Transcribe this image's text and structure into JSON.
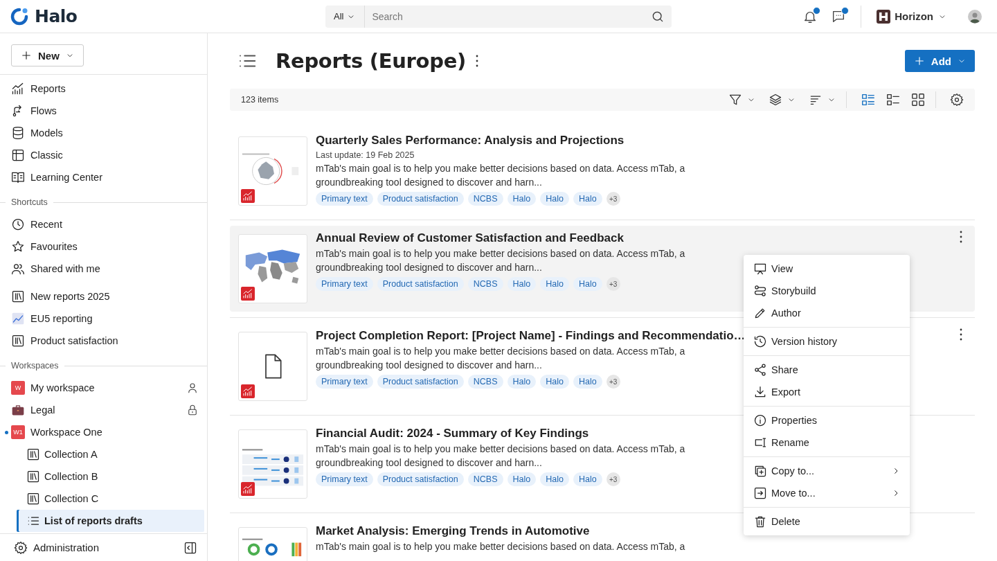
{
  "header": {
    "logo": "Halo",
    "search": {
      "scope": "All",
      "placeholder": "Search"
    },
    "notifications": [
      {
        "kind": "bell",
        "unread": true
      },
      {
        "kind": "chat",
        "unread": true
      }
    ],
    "workspace": "Horizon"
  },
  "sidebar": {
    "new_button": "New",
    "groups": [
      {
        "items": [
          {
            "label": "Reports",
            "selected": false
          },
          {
            "label": "Flows",
            "selected": false
          },
          {
            "label": "Models",
            "selected": false
          },
          {
            "label": "Classic",
            "selected": false
          },
          {
            "label": "Learning Center",
            "selected": false
          }
        ]
      },
      {
        "title": "Shortcuts",
        "items": [
          {
            "label": "Recent",
            "selected": false
          },
          {
            "label": "Favourites",
            "selected": false
          },
          {
            "label": "Shared with me",
            "selected": false
          }
        ]
      },
      {
        "items": [
          {
            "label": "New reports 2025",
            "selected": false
          },
          {
            "label": "EU5 reporting",
            "selected": false
          },
          {
            "label": "Product satisfaction",
            "selected": false
          }
        ]
      },
      {
        "title": "Workspaces",
        "items": [
          {
            "label": "My workspace",
            "badge": "W",
            "selected": false
          },
          {
            "label": "Legal",
            "selected": false
          },
          {
            "label": "Workspace One",
            "badge": "W1",
            "has_updates": true,
            "selected": false,
            "children": [
              {
                "label": "Collection A",
                "selected": false
              },
              {
                "label": "Collection B",
                "selected": false
              },
              {
                "label": "Collection C",
                "selected": false
              },
              {
                "label": "List of reports drafts",
                "selected": true
              }
            ]
          }
        ]
      }
    ],
    "footer": "Administration"
  },
  "main": {
    "title": "Reports (Europe)",
    "add_button": "Add",
    "item_count": "123 items",
    "views": [
      {
        "kind": "details",
        "selected": true
      },
      {
        "kind": "list",
        "selected": false
      },
      {
        "kind": "grid",
        "selected": false
      }
    ],
    "reports": [
      {
        "title": "Quarterly Sales Performance: Analysis and Projections",
        "last_update": "Last update: 19 Feb 2025",
        "description": "mTab's main goal is to help you make better decisions based on data. Access mTab, a groundbreaking tool designed to discover and harn...",
        "tags": [
          "Primary text",
          "Product satisfaction",
          "NCBS",
          "Halo",
          "Halo",
          "Halo"
        ],
        "more_tags": "+3",
        "highlighted": false,
        "actions_visible": false
      },
      {
        "title": "Annual Review of Customer Satisfaction and Feedback",
        "description": "mTab's main goal is to help you make better decisions based on data. Access mTab, a groundbreaking tool designed to discover and harn...",
        "tags": [
          "Primary text",
          "Product satisfaction",
          "NCBS",
          "Halo",
          "Halo",
          "Halo"
        ],
        "more_tags": "+3",
        "highlighted": true,
        "actions_visible": true
      },
      {
        "title": "Project Completion Report: [Project Name] - Findings and Recommendatio…",
        "description": "mTab's main goal is to help you make better decisions based on data. Access mTab, a groundbreaking tool designed to discover and harn...",
        "tags": [
          "Primary text",
          "Product satisfaction",
          "NCBS",
          "Halo",
          "Halo",
          "Halo"
        ],
        "more_tags": "+3",
        "highlighted": false,
        "actions_visible": true
      },
      {
        "title": "Financial Audit: 2024 - Summary of Key Findings",
        "description": "mTab's main goal is to help you make better decisions based on data. Access mTab, a groundbreaking tool designed to discover and harn...",
        "tags": [
          "Primary text",
          "Product satisfaction",
          "NCBS",
          "Halo",
          "Halo",
          "Halo"
        ],
        "more_tags": "+3",
        "highlighted": false,
        "actions_visible": false
      },
      {
        "title": "Market Analysis: Emerging Trends in Automotive",
        "description": "mTab's main goal is to help you make better decisions based on data. Access mTab, a",
        "highlighted": false,
        "actions_visible": false
      }
    ]
  },
  "context_menu": {
    "groups": [
      [
        {
          "label": "View",
          "submenu": false
        },
        {
          "label": "Storybuild",
          "submenu": false
        },
        {
          "label": "Author",
          "submenu": false
        }
      ],
      [
        {
          "label": "Version history",
          "submenu": false
        }
      ],
      [
        {
          "label": "Share",
          "submenu": false
        },
        {
          "label": "Export",
          "submenu": false
        }
      ],
      [
        {
          "label": "Properties",
          "submenu": false
        },
        {
          "label": "Rename",
          "submenu": false
        }
      ],
      [
        {
          "label": "Copy to...",
          "submenu": true
        },
        {
          "label": "Move to...",
          "submenu": true
        }
      ],
      [
        {
          "label": "Delete",
          "submenu": false
        }
      ]
    ]
  }
}
